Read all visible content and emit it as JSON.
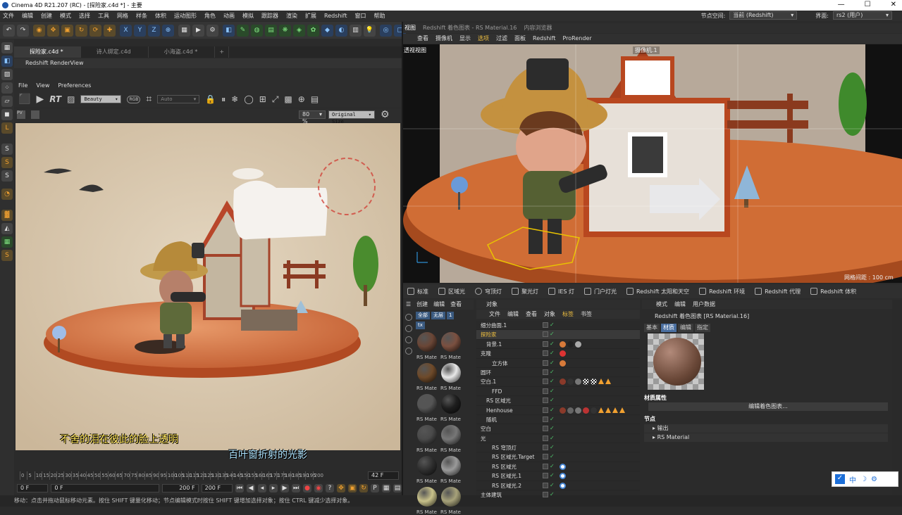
{
  "window": {
    "title": "Cinema 4D R21.207 (RC) - [探险家.c4d *] - 主要",
    "controls": [
      "—",
      "☐",
      "✕"
    ]
  },
  "menubar": {
    "items": [
      "文件",
      "编辑",
      "创建",
      "模式",
      "选择",
      "工具",
      "网格",
      "样条",
      "体积",
      "运动图形",
      "角色",
      "动画",
      "模拟",
      "跟踪器",
      "渲染",
      "扩展",
      "Redshift",
      "窗口",
      "帮助"
    ],
    "node_space_label": "节点空间:",
    "node_space_value": "当前 (Redshift)",
    "layout_label": "界面:",
    "layout_value": "rs2 (用户)"
  },
  "tabs": [
    "探险家.c4d *",
    "诗人绑定.c4d",
    "小海盗.c4d *",
    "+"
  ],
  "renderview": {
    "title": "Redshift RenderView",
    "menu": [
      "File",
      "View",
      "Preferences"
    ],
    "rt_label": "RT",
    "aov": "Beauty",
    "rgb": "RGB",
    "auto": "Auto",
    "zoom": "80 %",
    "size_mode": "Original Size"
  },
  "subtitles": {
    "line1": "不舍的泪在彼此的脸上透明",
    "line2": "百叶窗折射的光影"
  },
  "timeline": {
    "ticks": [
      "0",
      "5",
      "10",
      "15",
      "20",
      "25",
      "30",
      "35",
      "40",
      "45",
      "50",
      "55",
      "60",
      "65",
      "70",
      "75",
      "80",
      "85",
      "90",
      "95",
      "100",
      "105",
      "110",
      "115",
      "120",
      "125",
      "130",
      "135",
      "140",
      "145",
      "150",
      "155",
      "160",
      "165",
      "170",
      "175",
      "180",
      "185",
      "190",
      "195",
      "200"
    ],
    "current": "42 F",
    "start": "0 F",
    "start2": "0 F",
    "end": "200 F",
    "end2": "200 F"
  },
  "status": "移动：点击并拖动鼠标移动元素。按住 SHIFT 键量化移动；节点编辑模式时按住 SHIFT 键增加选择对象；按住 CTRL 键减少选择对象。",
  "viewport": {
    "menu1": [
      "视图",
      "Redshift 着色图表 - RS Material.16",
      "内容浏览器"
    ],
    "menu2": [
      "查看",
      "摄像机",
      "显示",
      "选项",
      "过滤",
      "面板",
      "Redshift",
      "ProRender"
    ],
    "label": "透视视图",
    "camera": "摄像机.1",
    "grid": "网格间距 : 100 cm"
  },
  "lights": [
    "标准",
    "区域光",
    "穹顶灯",
    "聚光灯",
    "IES 灯",
    "门户灯光",
    "Redshift 太阳和天空",
    "Redshift 环境",
    "Redshift 代理",
    "Redshift 体积"
  ],
  "material_manager": {
    "menu": [
      "创建",
      "编辑",
      "查看"
    ],
    "filters": [
      "全部",
      "无层",
      "1",
      "tx"
    ],
    "materials": [
      {
        "label": "RS Mate",
        "color": "#6a4636"
      },
      {
        "label": "RS Mate",
        "color": "#7b5040"
      },
      {
        "label": "RS Mate",
        "color": "#6e4a2a"
      },
      {
        "label": "RS Mate",
        "color": "#e8e8e8"
      },
      {
        "label": "RS Mate",
        "color": "#555555"
      },
      {
        "label": "RS Mate",
        "color": "#1e1e1e"
      },
      {
        "label": "RS Mate",
        "color": "#4a4a4a"
      },
      {
        "label": "RS Mate",
        "color": "#777777"
      },
      {
        "label": "RS Mate",
        "color": "#2f2f2f"
      },
      {
        "label": "RS Mate",
        "color": "#9a9a9a"
      },
      {
        "label": "RS Mate",
        "color": "#c9c28a"
      },
      {
        "label": "RS Mate",
        "color": "#a7a27a"
      }
    ]
  },
  "object_manager": {
    "title": "对象",
    "menu": [
      "文件",
      "编辑",
      "查看",
      "对象",
      "标签",
      "书签"
    ],
    "objects": [
      {
        "name": "细分曲面.1",
        "indent": 0,
        "tags": []
      },
      {
        "name": "探险家",
        "indent": 0,
        "tags": [],
        "highlight": true
      },
      {
        "name": "背景.1",
        "indent": 1,
        "tags": [
          "#d77a3a",
          "#222",
          "#aaa"
        ]
      },
      {
        "name": "克隆",
        "indent": 0,
        "tags": [
          "#d33"
        ]
      },
      {
        "name": "立方体",
        "indent": 2,
        "tags": [
          "#d77a3a"
        ]
      },
      {
        "name": "圆环",
        "indent": 0,
        "tags": []
      },
      {
        "name": "空白.1",
        "indent": 0,
        "tags": [
          "#8a3a2a",
          "#333",
          "#777",
          "chk",
          "chk",
          "tri",
          "tri"
        ]
      },
      {
        "name": "FFD",
        "indent": 2,
        "tags": []
      },
      {
        "name": "RS 区域光",
        "indent": 1,
        "tags": []
      },
      {
        "name": "Henhouse",
        "indent": 1,
        "tags": [
          "#8a3a2a",
          "#666",
          "#777",
          "#b33",
          "#333",
          "tri",
          "tri",
          "tri",
          "tri"
        ]
      },
      {
        "name": "随机",
        "indent": 1,
        "tags": []
      },
      {
        "name": "空白",
        "indent": 0,
        "tags": []
      },
      {
        "name": "光",
        "indent": 0,
        "tags": []
      },
      {
        "name": "RS 穹顶灯",
        "indent": 2,
        "tags": []
      },
      {
        "name": "RS 区域光.Target",
        "indent": 2,
        "tags": []
      },
      {
        "name": "RS 区域光",
        "indent": 2,
        "tags": [
          "target"
        ]
      },
      {
        "name": "RS 区域光.1",
        "indent": 2,
        "tags": [
          "target"
        ]
      },
      {
        "name": "RS 区域光.2",
        "indent": 2,
        "tags": [
          "target"
        ]
      },
      {
        "name": "主体建筑",
        "indent": 0,
        "tags": []
      }
    ]
  },
  "attributes": {
    "menu": [
      "模式",
      "编辑",
      "用户数据"
    ],
    "title": "Redshift 着色图表 [RS Material.16]",
    "tabs": [
      "基本",
      "材质",
      "编辑",
      "指定"
    ],
    "section1": "材质属性",
    "edit_button": "编辑着色图表...",
    "section2": "节点",
    "folds": [
      "输出",
      "RS Material"
    ]
  },
  "ime": {
    "items": [
      "中",
      "☽",
      "⚙"
    ]
  }
}
